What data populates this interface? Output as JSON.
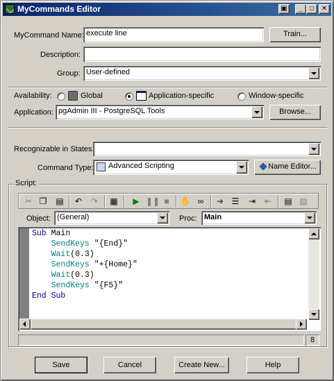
{
  "window": {
    "title": "MyCommands Editor",
    "controls": [
      "restore",
      "minimize",
      "maximize",
      "close"
    ]
  },
  "form": {
    "name_label": "MyCommand Name:",
    "name_value": "execute line",
    "train_label": "Train...",
    "description_label": "Description:",
    "description_value": "",
    "group_label": "Group:",
    "group_value": "User-defined",
    "availability_label": "Availability:",
    "availability_options": [
      {
        "label": "Global",
        "selected": false,
        "icon": "global-icon"
      },
      {
        "label": "Application-specific",
        "selected": true,
        "icon": "window-icon"
      },
      {
        "label": "Window-specific",
        "selected": false,
        "icon": ""
      }
    ],
    "application_label": "Application:",
    "application_value": "pgAdmin III - PostgreSQL Tools",
    "browse_label": "Browse...",
    "states_label": "Recognizable in States:",
    "states_value": "",
    "command_type_label": "Command Type:",
    "command_type_value": "Advanced Scripting",
    "name_editor_label": "Name Editor..."
  },
  "script": {
    "group_label": "Script:",
    "object_label": "Object:",
    "object_value": "(General)",
    "proc_label": "Proc:",
    "proc_value": "Main",
    "code_lines": [
      {
        "kw": "Sub",
        "fn": "",
        "rest": " Main",
        "indent": ""
      },
      {
        "kw": "",
        "fn": "SendKeys",
        "rest": " \"{End}\"",
        "indent": "    "
      },
      {
        "kw": "",
        "fn": "Wait",
        "rest": "(0.3)",
        "indent": "    "
      },
      {
        "kw": "",
        "fn": "SendKeys",
        "rest": " \"+{Home}\"",
        "indent": "    "
      },
      {
        "kw": "",
        "fn": "Wait",
        "rest": "(0.3)",
        "indent": "    "
      },
      {
        "kw": "",
        "fn": "SendKeys",
        "rest": " \"{F5}\"",
        "indent": "    "
      },
      {
        "kw": "End Sub",
        "fn": "",
        "rest": "",
        "indent": ""
      }
    ],
    "line_indicator": "8"
  },
  "footer": {
    "save_label": "Save",
    "cancel_label": "Cancel",
    "create_new_label": "Create New...",
    "help_label": "Help"
  },
  "colors": {
    "titlebar_start": "#0a246a",
    "titlebar_end": "#3a6ea5",
    "face": "#d4d0c8",
    "keyword": "#00008b",
    "function": "#008080"
  }
}
